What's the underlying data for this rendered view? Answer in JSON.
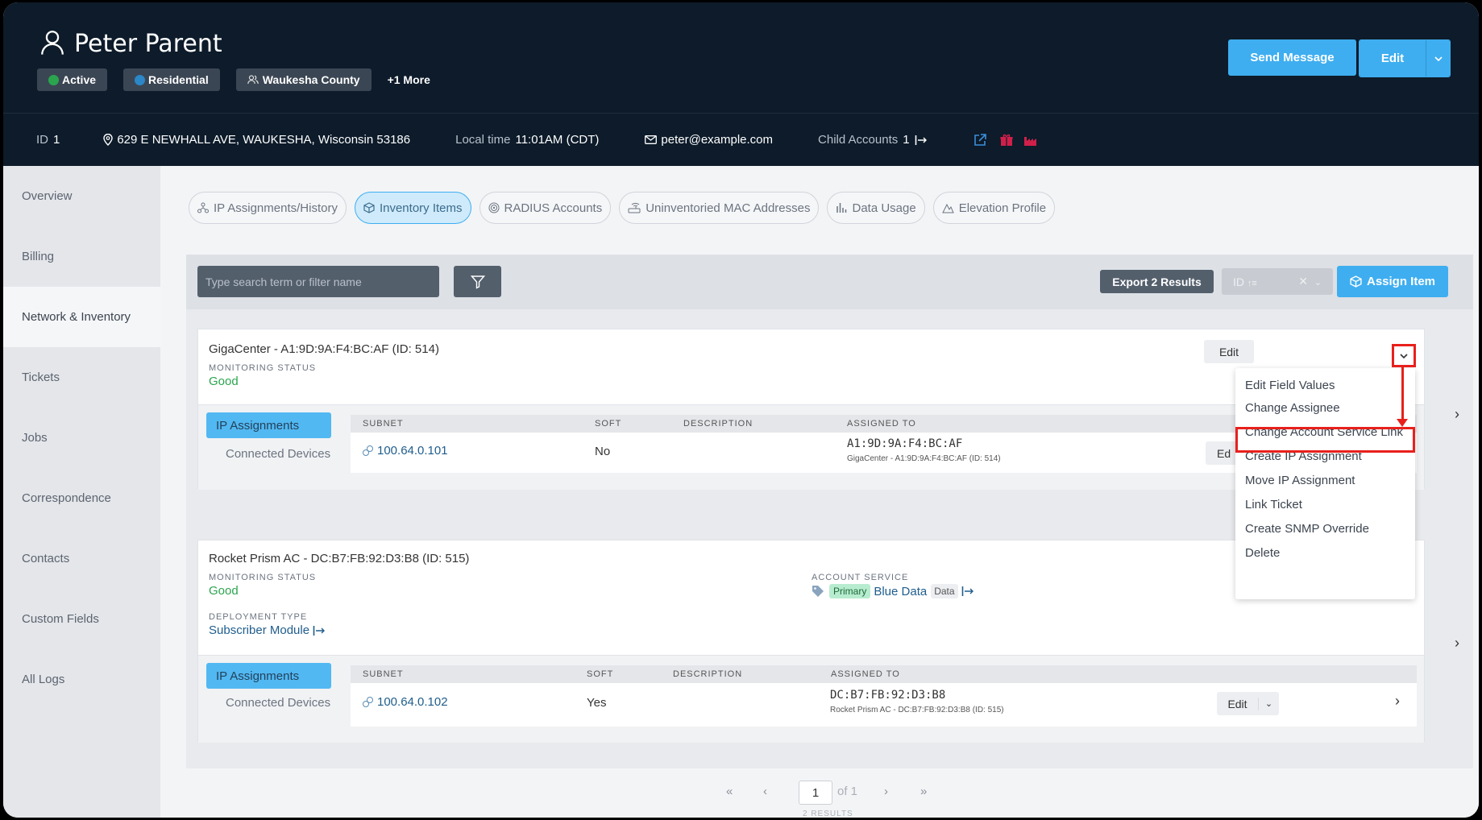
{
  "header": {
    "user_name": "Peter Parent",
    "badges": [
      {
        "label": "Active",
        "color": "#2aa54e"
      },
      {
        "label": "Residential",
        "color": "#2b87c7"
      },
      {
        "label": "Waukesha County"
      }
    ],
    "more_label": "+1 More",
    "send_message": "Send Message",
    "edit": "Edit"
  },
  "info": {
    "id_label": "ID",
    "id_value": "1",
    "address": "629 E NEWHALL AVE, WAUKESHA, Wisconsin 53186",
    "local_time_label": "Local time",
    "local_time": "11:01AM (CDT)",
    "email": "peter@example.com",
    "child_accounts_label": "Child Accounts",
    "child_accounts_count": "1"
  },
  "sidebar": {
    "items": [
      {
        "label": "Overview"
      },
      {
        "label": "Billing"
      },
      {
        "label": "Network & Inventory",
        "active": true
      },
      {
        "label": "Tickets"
      },
      {
        "label": "Jobs"
      },
      {
        "label": "Correspondence"
      },
      {
        "label": "Contacts"
      },
      {
        "label": "Custom Fields"
      },
      {
        "label": "All Logs"
      }
    ]
  },
  "tabs": [
    {
      "label": "IP Assignments/History"
    },
    {
      "label": "Inventory Items",
      "active": true
    },
    {
      "label": "RADIUS Accounts"
    },
    {
      "label": "Uninventoried MAC Addresses"
    },
    {
      "label": "Data Usage"
    },
    {
      "label": "Elevation Profile"
    }
  ],
  "toolbar": {
    "search_placeholder": "Type search term or filter name",
    "export_label": "Export 2 Results",
    "sort_label": "ID",
    "assign_label": "Assign Item"
  },
  "items": [
    {
      "title": "GigaCenter - A1:9D:9A:F4:BC:AF (ID: 514)",
      "monitoring_label": "MONITORING STATUS",
      "monitoring_value": "Good",
      "edit": "Edit",
      "subtabs": [
        "IP Assignments",
        "Connected Devices"
      ],
      "columns": [
        "SUBNET",
        "SOFT",
        "DESCRIPTION",
        "ASSIGNED TO"
      ],
      "row": {
        "subnet": "100.64.0.101",
        "soft": "No",
        "assigned_mac": "A1:9D:9A:F4:BC:AF",
        "assigned_detail": "GigaCenter - A1:9D:9A:F4:BC:AF (ID: 514)",
        "edit": "Ed"
      }
    },
    {
      "title": "Rocket Prism AC - DC:B7:FB:92:D3:B8 (ID: 515)",
      "monitoring_label": "MONITORING STATUS",
      "monitoring_value": "Good",
      "account_service_label": "ACCOUNT SERVICE",
      "service_primary": "Primary",
      "service_name": "Blue Data",
      "service_type": "Data",
      "deployment_label": "DEPLOYMENT TYPE",
      "deployment_value": "Subscriber Module",
      "subtabs": [
        "IP Assignments",
        "Connected Devices"
      ],
      "columns": [
        "SUBNET",
        "SOFT",
        "DESCRIPTION",
        "ASSIGNED TO"
      ],
      "row": {
        "subnet": "100.64.0.102",
        "soft": "Yes",
        "assigned_mac": "DC:B7:FB:92:D3:B8",
        "assigned_detail": "Rocket Prism AC - DC:B7:FB:92:D3:B8 (ID: 515)",
        "edit": "Edit"
      }
    }
  ],
  "dropdown": {
    "items": [
      "Edit Field Values",
      "Change Assignee",
      "Change Account Service Link",
      "Create IP Assignment",
      "Move IP Assignment",
      "Link Ticket",
      "Create SNMP Override",
      "Delete"
    ]
  },
  "pagination": {
    "first": "«",
    "prev": "‹",
    "page": "1",
    "of_label": "of 1",
    "next": "›",
    "last": "»",
    "results": "2 RESULTS"
  }
}
